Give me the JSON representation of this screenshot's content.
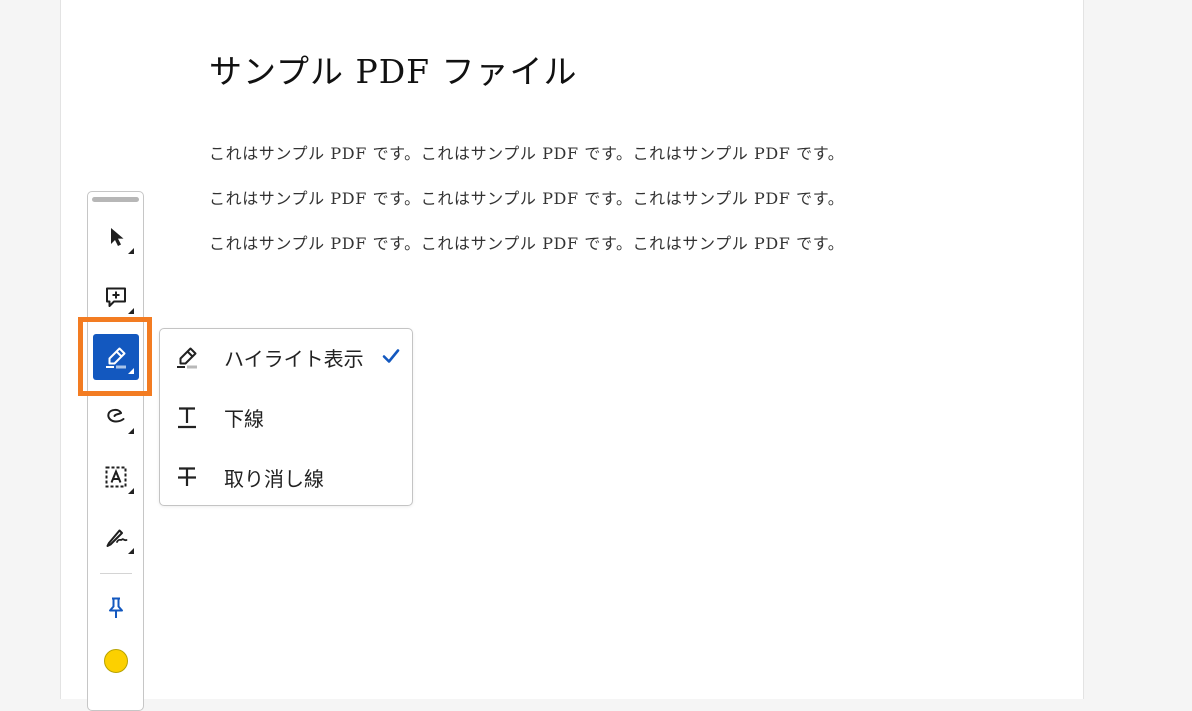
{
  "document": {
    "title": "サンプル PDF ファイル",
    "lines": [
      "これはサンプル PDF です。これはサンプル PDF です。これはサンプル PDF です。",
      "これはサンプル PDF です。これはサンプル PDF です。これはサンプル PDF です。",
      "これはサンプル PDF です。これはサンプル PDF です。これはサンプル PDF です。"
    ]
  },
  "toolbar": {
    "tools": [
      {
        "icon": "select-arrow-icon"
      },
      {
        "icon": "add-comment-icon"
      },
      {
        "icon": "highlight-pen-icon",
        "active": true,
        "highlighted": true
      },
      {
        "icon": "freehand-draw-icon"
      },
      {
        "icon": "text-box-icon"
      },
      {
        "icon": "signature-icon"
      },
      {
        "icon": "pin-icon"
      }
    ],
    "active_color": "#1358bf",
    "highlight_frame_color": "#f37c22",
    "annotation_color": "#fcd000"
  },
  "menu": {
    "items": [
      {
        "label": "ハイライト表示",
        "icon": "highlight-pen-icon",
        "checked": true
      },
      {
        "label": "下線",
        "icon": "underline-icon",
        "checked": false
      },
      {
        "label": "取り消し線",
        "icon": "strikethrough-icon",
        "checked": false
      }
    ],
    "check_color": "#1358bf"
  }
}
